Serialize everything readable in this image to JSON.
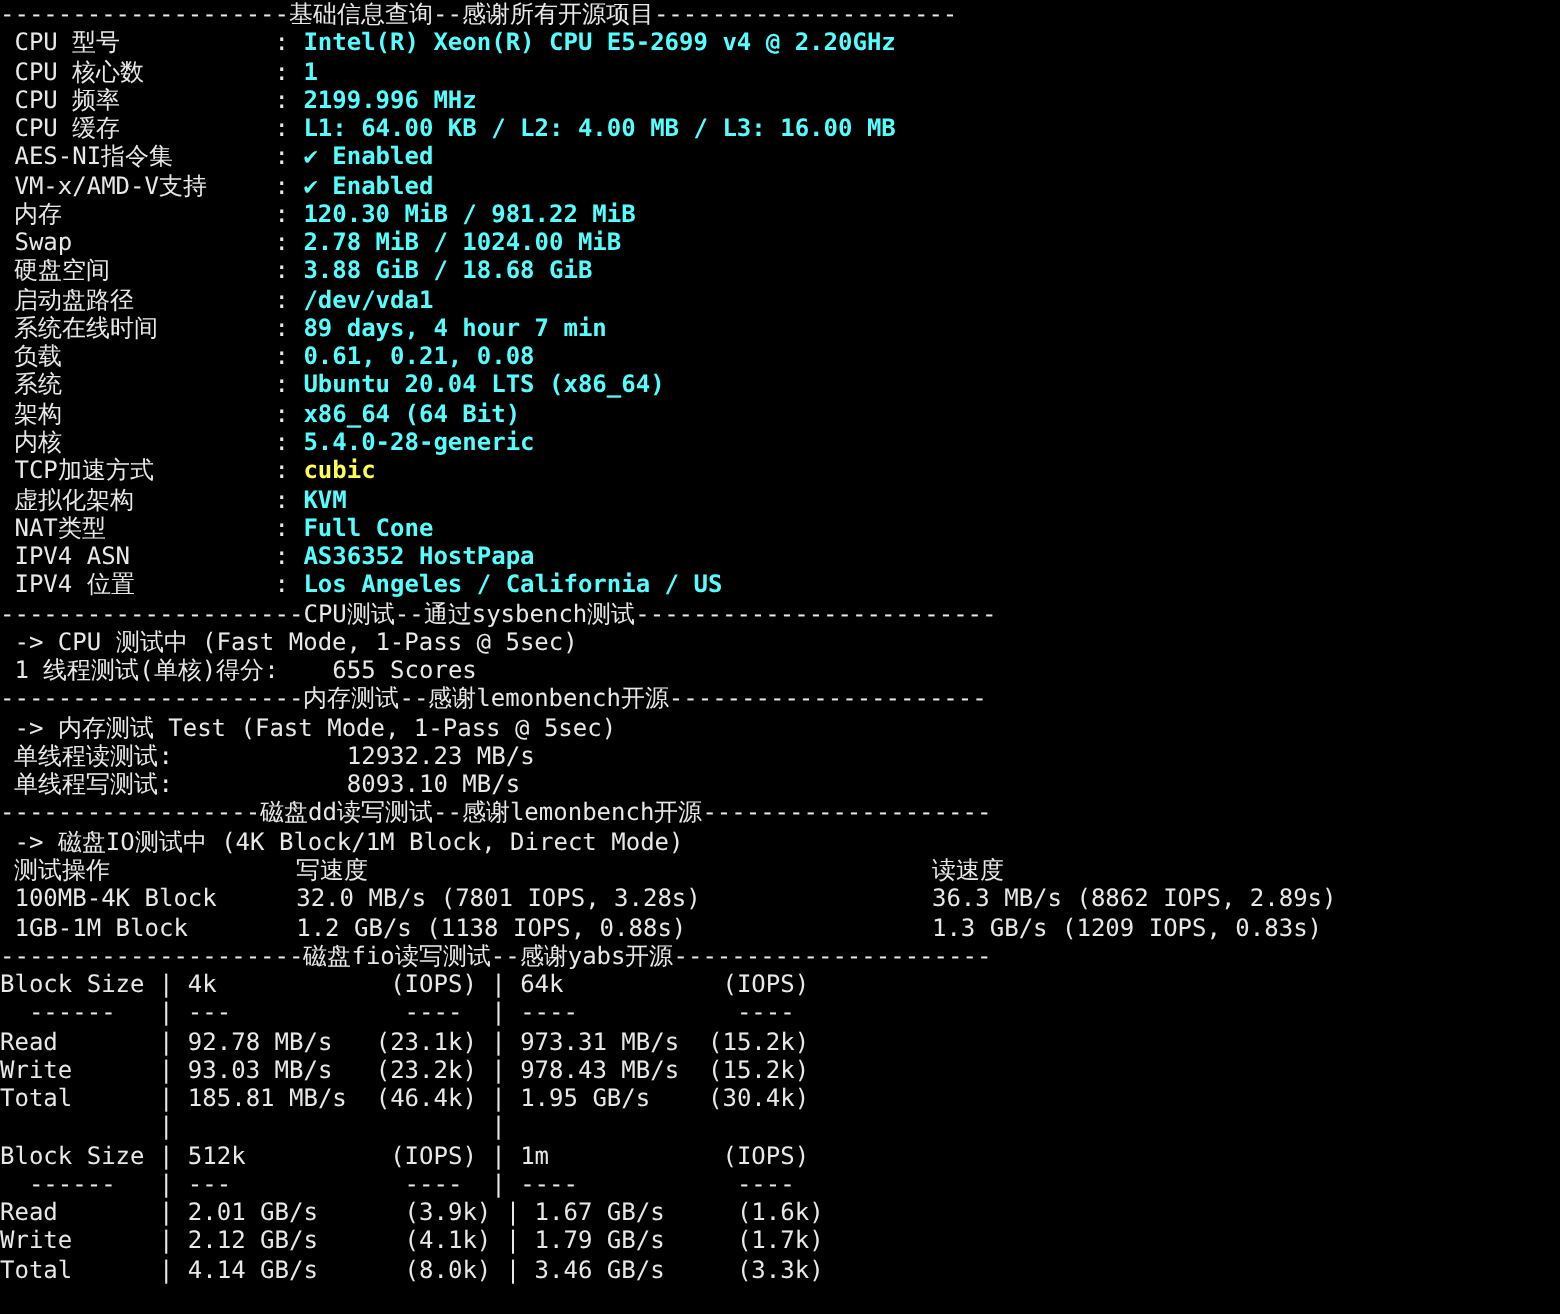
{
  "terminal": {
    "lines": [
      {
        "kind": "rule",
        "text": "--------------------基础信息查询--感谢所有开源项目---------------------"
      },
      {
        "kind": "info",
        "label": "CPU 型号",
        "sep": ":",
        "value": "Intel(R) Xeon(R) CPU E5-2699 v4 @ 2.20GHz",
        "color": "#55ffff"
      },
      {
        "kind": "info",
        "label": "CPU 核心数",
        "sep": ":",
        "value": "1",
        "color": "#55ffff"
      },
      {
        "kind": "info",
        "label": "CPU 频率",
        "sep": ":",
        "value": "2199.996 MHz",
        "color": "#55ffff"
      },
      {
        "kind": "info",
        "label": "CPU 缓存",
        "sep": ":",
        "value": "L1: 64.00 KB / L2: 4.00 MB / L3: 16.00 MB",
        "color": "#55ffff"
      },
      {
        "kind": "info",
        "label": "AES-NI指令集",
        "sep": ":",
        "value": "✔ Enabled",
        "color": "#55ffff"
      },
      {
        "kind": "info",
        "label": "VM-x/AMD-V支持",
        "sep": ":",
        "value": "✔ Enabled",
        "color": "#55ffff"
      },
      {
        "kind": "info",
        "label": "内存",
        "sep": ":",
        "value": "120.30 MiB / 981.22 MiB",
        "color": "#55ffff"
      },
      {
        "kind": "info",
        "label": "Swap",
        "sep": ":",
        "value": "2.78 MiB / 1024.00 MiB",
        "color": "#55ffff"
      },
      {
        "kind": "info",
        "label": "硬盘空间",
        "sep": ":",
        "value": "3.88 GiB / 18.68 GiB",
        "color": "#55ffff"
      },
      {
        "kind": "info",
        "label": "启动盘路径",
        "sep": ":",
        "value": "/dev/vda1",
        "color": "#55ffff"
      },
      {
        "kind": "info",
        "label": "系统在线时间",
        "sep": ":",
        "value": "89 days, 4 hour 7 min",
        "color": "#55ffff"
      },
      {
        "kind": "info",
        "label": "负载",
        "sep": ":",
        "value": "0.61, 0.21, 0.08",
        "color": "#55ffff"
      },
      {
        "kind": "info",
        "label": "系统",
        "sep": ":",
        "value": "Ubuntu 20.04 LTS (x86_64)",
        "color": "#55ffff"
      },
      {
        "kind": "info",
        "label": "架构",
        "sep": ":",
        "value": "x86_64 (64 Bit)",
        "color": "#55ffff"
      },
      {
        "kind": "info",
        "label": "内核",
        "sep": ":",
        "value": "5.4.0-28-generic",
        "color": "#55ffff"
      },
      {
        "kind": "info",
        "label": "TCP加速方式",
        "sep": ":",
        "value": "cubic",
        "color": "#ffff55"
      },
      {
        "kind": "info",
        "label": "虚拟化架构",
        "sep": ":",
        "value": "KVM",
        "color": "#55ffff"
      },
      {
        "kind": "info",
        "label": "NAT类型",
        "sep": ":",
        "value": "Full Cone",
        "color": "#55ffff"
      },
      {
        "kind": "info",
        "label": "IPV4 ASN",
        "sep": ":",
        "value": "AS36352 HostPapa",
        "color": "#55ffff"
      },
      {
        "kind": "info",
        "label": "IPV4 位置",
        "sep": ":",
        "value": "Los Angeles / California / US",
        "color": "#55ffff"
      },
      {
        "kind": "rule",
        "text": "---------------------CPU测试--通过sysbench测试-------------------------"
      },
      {
        "kind": "note",
        "text": "-> CPU 测试中 (Fast Mode, 1-Pass @ 5sec)"
      },
      {
        "kind": "score",
        "label": "1 线程测试(单核)得分:",
        "value": "655 Scores"
      },
      {
        "kind": "rule",
        "text": "---------------------内存测试--感谢lemonbench开源----------------------"
      },
      {
        "kind": "note",
        "text": "-> 内存测试 Test (Fast Mode, 1-Pass @ 5sec)"
      },
      {
        "kind": "mem",
        "label": "单线程读测试:",
        "value": "12932.23 MB/s"
      },
      {
        "kind": "mem",
        "label": "单线程写测试:",
        "value": "8093.10 MB/s"
      },
      {
        "kind": "rule",
        "text": "------------------磁盘dd读写测试--感谢lemonbench开源--------------------"
      },
      {
        "kind": "note",
        "text": "-> 磁盘IO测试中 (4K Block/1M Block, Direct Mode)"
      },
      {
        "kind": "io",
        "cells": [
          "测试操作",
          "写速度",
          "读速度"
        ]
      },
      {
        "kind": "io",
        "cells": [
          "100MB-4K Block",
          "32.0 MB/s (7801 IOPS, 3.28s)",
          "36.3 MB/s (8862 IOPS, 2.89s)"
        ]
      },
      {
        "kind": "io",
        "cells": [
          "1GB-1M Block",
          "1.2 GB/s (1138 IOPS, 0.88s)",
          "1.3 GB/s (1209 IOPS, 0.83s)"
        ]
      },
      {
        "kind": "rule",
        "text": "---------------------磁盘fio读写测试--感谢yabs开源----------------------"
      },
      {
        "kind": "table",
        "text": "Block Size | 4k            (IOPS) | 64k           (IOPS)"
      },
      {
        "kind": "table",
        "text": "  ------   | ---            ----  | ----           ---- "
      },
      {
        "kind": "table",
        "text": "Read       | 92.78 MB/s   (23.1k) | 973.31 MB/s  (15.2k)"
      },
      {
        "kind": "table",
        "text": "Write      | 93.03 MB/s   (23.2k) | 978.43 MB/s  (15.2k)"
      },
      {
        "kind": "table",
        "text": "Total      | 185.81 MB/s  (46.4k) | 1.95 GB/s    (30.4k)"
      },
      {
        "kind": "table",
        "text": "           |                      |                     "
      },
      {
        "kind": "table",
        "text": "Block Size | 512k          (IOPS) | 1m            (IOPS)"
      },
      {
        "kind": "table",
        "text": "  ------   | ---            ----  | ----           ---- "
      },
      {
        "kind": "table",
        "text": "Read       | 2.01 GB/s      (3.9k) | 1.67 GB/s     (1.6k)"
      },
      {
        "kind": "table",
        "text": "Write      | 2.12 GB/s      (4.1k) | 1.79 GB/s     (1.7k)"
      },
      {
        "kind": "table",
        "text": "Total      | 4.14 GB/s      (8.0k) | 3.46 GB/s     (3.3k)"
      }
    ]
  }
}
